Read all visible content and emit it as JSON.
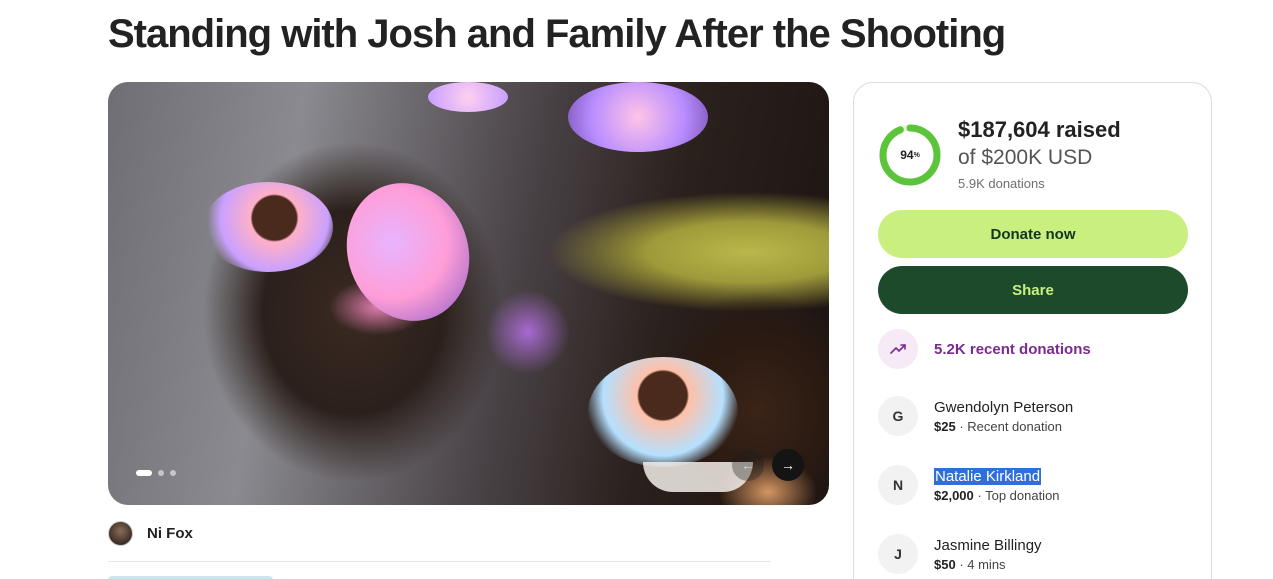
{
  "page": {
    "title": "Standing with Josh and Family After the Shooting"
  },
  "media": {
    "slides_total": 3,
    "active_slide": 1,
    "prev_icon": "arrow-left-icon",
    "next_icon": "arrow-right-icon",
    "prev_glyph": "←",
    "next_glyph": "→"
  },
  "organizer": {
    "name": "Ni Fox"
  },
  "fundraiser": {
    "progress_percent": 94,
    "progress_label": "94",
    "progress_unit": "%",
    "raised": "$187,604 raised",
    "goal": "of $200K USD",
    "donation_count": "5.9K donations",
    "donate_label": "Donate now",
    "share_label": "Share",
    "recent_label": "5.2K recent donations",
    "recent_icon": "trending-up-icon"
  },
  "donors": [
    {
      "initial": "G",
      "name": "Gwendolyn Peterson",
      "amount": "$25",
      "note": " · Recent donation"
    },
    {
      "initial": "N",
      "name": "Natalie Kirkland",
      "amount": "$2,000",
      "note": " · Top donation"
    },
    {
      "initial": "J",
      "name": "Jasmine Billingy",
      "amount": "$50",
      "note": " · 4 mins"
    }
  ],
  "colors": {
    "accent_green": "#c9f07f",
    "dark_green": "#1e4a2c",
    "purple": "#7a2a91",
    "ring_track": "#e9f5e1",
    "ring_fill": "#5bc43a"
  }
}
